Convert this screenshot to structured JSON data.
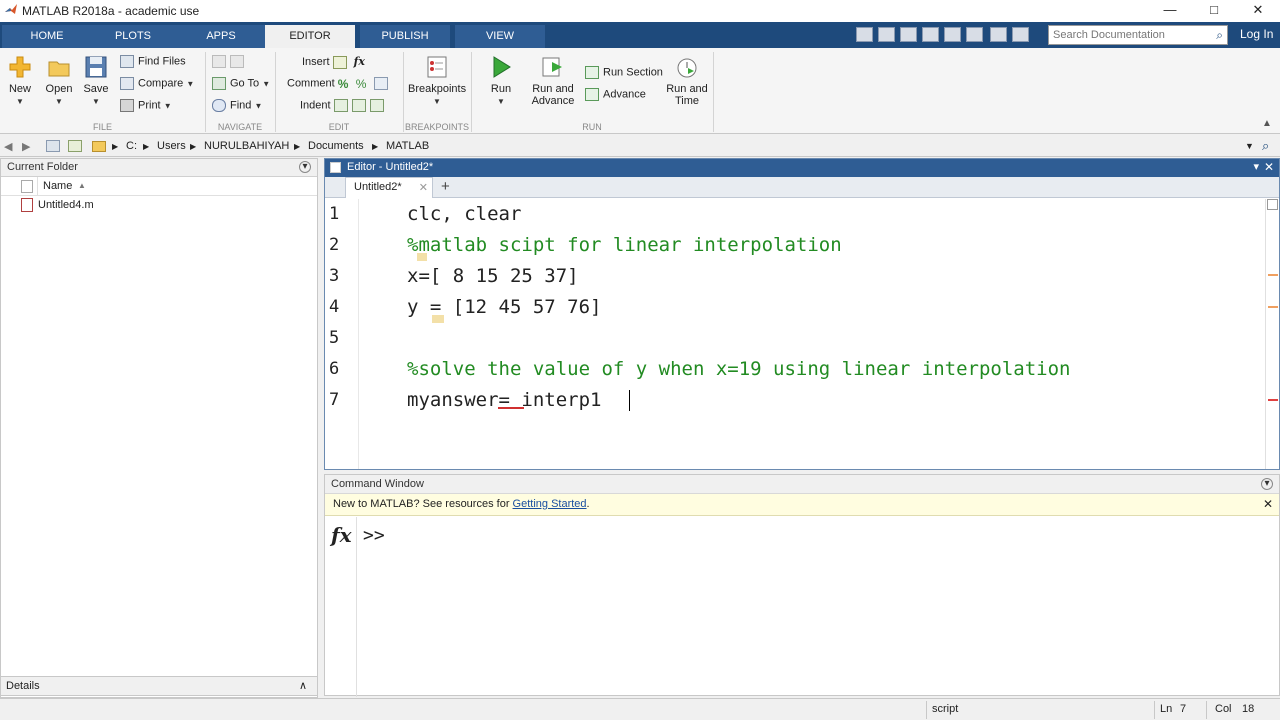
{
  "window": {
    "title": "MATLAB R2018a - academic use"
  },
  "tabs": [
    "HOME",
    "PLOTS",
    "APPS",
    "EDITOR",
    "PUBLISH",
    "VIEW"
  ],
  "active_tab": "EDITOR",
  "search": {
    "placeholder": "Search Documentation"
  },
  "login_label": "Log In",
  "ribbon": {
    "file": {
      "new": "New",
      "open": "Open",
      "save": "Save",
      "find_files": "Find Files",
      "compare": "Compare",
      "print": "Print",
      "group": "FILE"
    },
    "navigate": {
      "go_to": "Go To",
      "find": "Find",
      "group": "NAVIGATE"
    },
    "edit": {
      "insert": "Insert",
      "comment": "Comment",
      "indent": "Indent",
      "fx": "fx",
      "group": "EDIT"
    },
    "breakpoints": {
      "label": "Breakpoints",
      "group": "BREAKPOINTS"
    },
    "run": {
      "run": "Run",
      "run_and_advance_1": "Run and",
      "run_and_advance_2": "Advance",
      "run_section": "Run Section",
      "advance": "Advance",
      "run_and_time_1": "Run and",
      "run_and_time_2": "Time",
      "group": "RUN"
    }
  },
  "address": {
    "segments": [
      "C:",
      "Users",
      "NURULBAHIYAH",
      "Documents",
      "MATLAB"
    ]
  },
  "current_folder": {
    "title": "Current Folder",
    "column": "Name",
    "files": [
      "Untitled4.m"
    ]
  },
  "details_label": "Details",
  "editor": {
    "title": "Editor - Untitled2*",
    "tab": "Untitled2*",
    "lines": [
      {
        "n": "1",
        "text": "clc, clear"
      },
      {
        "n": "2",
        "text": "%matlab scipt for linear interpolation"
      },
      {
        "n": "3",
        "text": "x=[ 8 15 25 37]"
      },
      {
        "n": "4",
        "text": "y = [12 45 57 76]"
      },
      {
        "n": "5",
        "text": ""
      },
      {
        "n": "6",
        "text": "%solve the value of y when x=19 using linear interpolation"
      },
      {
        "n": "7",
        "text": "myanswer= interp1"
      }
    ]
  },
  "command_window": {
    "title": "Command Window",
    "notice_prefix": "New to MATLAB? See resources for ",
    "notice_link": "Getting Started",
    "notice_suffix": ".",
    "fx": "fx",
    "prompt": ">>"
  },
  "statusbar": {
    "mode": "script",
    "ln_label": "Ln",
    "ln": "7",
    "col_label": "Col",
    "col": "18"
  },
  "colors": {
    "tabstrip": "#1e4a7c",
    "editor_title": "#2f5d94",
    "comment": "#228b22",
    "link": "#1a4fa0"
  }
}
